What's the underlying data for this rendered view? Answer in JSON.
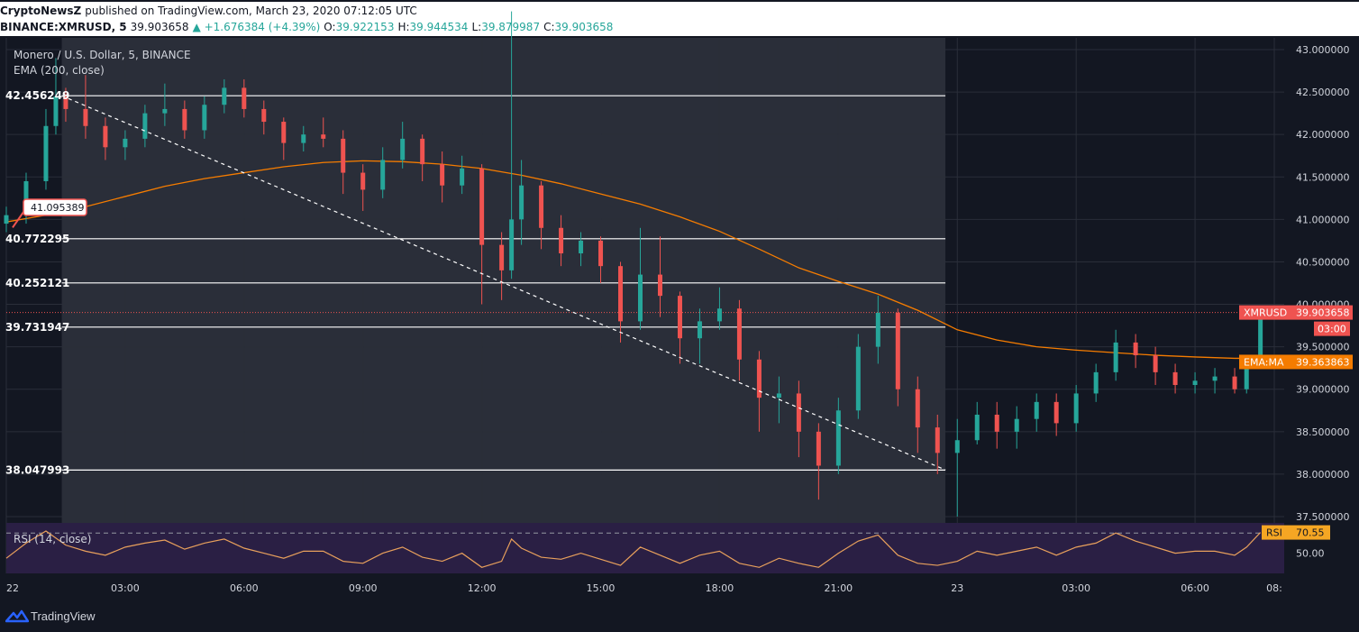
{
  "header": {
    "publisher": "CryptoNewsZ",
    "published_text": "published on TradingView.com, March 23, 2020 07:12:05 UTC",
    "symbol_label": "BINANCE:XMRUSD, 5",
    "last": "39.903658",
    "change": "▲ +1.676384 (+4.39%)",
    "o_label": "O:",
    "o": "39.922153",
    "h_label": "H:",
    "h": "39.944534",
    "l_label": "L:",
    "l": "39.879987",
    "c_label": "C:",
    "c": "39.903658"
  },
  "legend": {
    "title": "Monero / U.S. Dollar, 5, BINANCE",
    "ema": "EMA (200, close)",
    "rsi": "RSI (14, close)"
  },
  "brand": "TradingView",
  "colors": {
    "background": "#131722",
    "up": "#26a69a",
    "down": "#ef5350",
    "ema": "#f57c00",
    "rsi": "#e8a05c",
    "rsi_band": "#2a1f44",
    "highlight": "#2a2e39",
    "price_label": "#ef5350",
    "ema_label": "#f57c00",
    "rsi_label": "#f5a623"
  },
  "chart_data": {
    "type": "candlestick",
    "title": "Monero / U.S. Dollar, 5, BINANCE",
    "ylim": [
      37.5,
      43.0
    ],
    "y_ticks": [
      "43.000000",
      "42.500000",
      "42.000000",
      "41.500000",
      "41.000000",
      "40.500000",
      "40.000000",
      "39.500000",
      "39.000000",
      "38.500000",
      "38.000000",
      "37.500000"
    ],
    "x_tick_labels": [
      "22",
      "03:00",
      "06:00",
      "09:00",
      "12:00",
      "15:00",
      "18:00",
      "21:00",
      "23",
      "03:00",
      "06:00",
      "08:"
    ],
    "x_tick_hours": [
      0,
      3,
      6,
      9,
      12,
      15,
      18,
      21,
      24,
      27,
      30,
      32
    ],
    "xlim_hours": [
      0,
      32.25
    ],
    "highlight_range_hours": [
      1.4,
      23.7
    ],
    "levels": [
      {
        "value": 42.456249,
        "label": "42.456249"
      },
      {
        "value": 40.772295,
        "label": "40.772295"
      },
      {
        "value": 40.252121,
        "label": "40.252121"
      },
      {
        "value": 39.731947,
        "label": "39.731947"
      },
      {
        "value": 38.047993,
        "label": "38.047993"
      }
    ],
    "callout": {
      "label": "41.095389",
      "hour": 0.25,
      "value": 41.095389
    },
    "trendline": {
      "start": [
        1.4,
        42.456249
      ],
      "end": [
        23.7,
        38.05
      ]
    },
    "current_price": {
      "value": 39.903658,
      "label": "39.903658",
      "symbol": "XMRUSD",
      "countdown": "03:00"
    },
    "ema": {
      "name": "EMA (200, close)",
      "label_name": "EMA:MA",
      "value": 39.363863,
      "label": "39.363863",
      "points": [
        [
          0,
          40.97
        ],
        [
          1,
          41.05
        ],
        [
          2,
          41.15
        ],
        [
          3,
          41.27
        ],
        [
          4,
          41.39
        ],
        [
          5,
          41.48
        ],
        [
          6,
          41.55
        ],
        [
          7,
          41.62
        ],
        [
          8,
          41.67
        ],
        [
          9,
          41.69
        ],
        [
          10,
          41.68
        ],
        [
          11,
          41.65
        ],
        [
          12,
          41.6
        ],
        [
          13,
          41.52
        ],
        [
          14,
          41.42
        ],
        [
          15,
          41.3
        ],
        [
          16,
          41.18
        ],
        [
          17,
          41.03
        ],
        [
          18,
          40.86
        ],
        [
          19,
          40.65
        ],
        [
          20,
          40.43
        ],
        [
          21,
          40.27
        ],
        [
          22,
          40.12
        ],
        [
          23,
          39.93
        ],
        [
          24,
          39.7
        ],
        [
          25,
          39.58
        ],
        [
          26,
          39.5
        ],
        [
          27,
          39.46
        ],
        [
          28,
          39.43
        ],
        [
          29,
          39.4
        ],
        [
          30,
          39.38
        ],
        [
          31,
          39.364
        ],
        [
          31.65,
          39.364
        ]
      ]
    },
    "candles": [
      [
        0.0,
        40.95,
        41.05,
        41.15,
        40.85
      ],
      [
        0.5,
        41.05,
        41.45,
        41.55,
        40.95
      ],
      [
        1.0,
        41.45,
        42.1,
        42.3,
        41.35
      ],
      [
        1.25,
        42.1,
        42.45,
        42.9,
        42.0
      ],
      [
        1.5,
        42.45,
        42.3,
        42.55,
        42.15
      ],
      [
        2.0,
        42.3,
        42.1,
        42.7,
        41.95
      ],
      [
        2.5,
        42.1,
        41.85,
        42.2,
        41.7
      ],
      [
        3.0,
        41.85,
        41.95,
        42.05,
        41.7
      ],
      [
        3.5,
        41.95,
        42.25,
        42.35,
        41.85
      ],
      [
        4.0,
        42.25,
        42.3,
        42.6,
        42.1
      ],
      [
        4.5,
        42.3,
        42.05,
        42.4,
        41.95
      ],
      [
        5.0,
        42.05,
        42.35,
        42.45,
        41.95
      ],
      [
        5.5,
        42.35,
        42.55,
        42.65,
        42.25
      ],
      [
        6.0,
        42.55,
        42.3,
        42.65,
        42.2
      ],
      [
        6.5,
        42.3,
        42.15,
        42.4,
        42.0
      ],
      [
        7.0,
        42.15,
        41.9,
        42.2,
        41.7
      ],
      [
        7.5,
        41.9,
        42.0,
        42.1,
        41.8
      ],
      [
        8.0,
        42.0,
        41.95,
        42.2,
        41.85
      ],
      [
        8.5,
        41.95,
        41.55,
        42.05,
        41.3
      ],
      [
        9.0,
        41.55,
        41.35,
        41.65,
        41.1
      ],
      [
        9.5,
        41.35,
        41.7,
        41.85,
        41.25
      ],
      [
        10.0,
        41.7,
        41.95,
        42.15,
        41.6
      ],
      [
        10.5,
        41.95,
        41.65,
        42.0,
        41.45
      ],
      [
        11.0,
        41.65,
        41.4,
        41.8,
        41.2
      ],
      [
        11.5,
        41.4,
        41.6,
        41.75,
        41.3
      ],
      [
        12.0,
        41.6,
        40.7,
        41.65,
        40.0
      ],
      [
        12.5,
        40.7,
        40.4,
        40.85,
        40.05
      ],
      [
        12.75,
        40.4,
        41.0,
        43.45,
        40.3
      ],
      [
        13.0,
        41.0,
        41.4,
        41.7,
        40.7
      ],
      [
        13.5,
        41.4,
        40.9,
        41.45,
        40.65
      ],
      [
        14.0,
        40.9,
        40.6,
        41.05,
        40.45
      ],
      [
        14.5,
        40.6,
        40.75,
        40.85,
        40.45
      ],
      [
        15.0,
        40.75,
        40.45,
        40.8,
        40.25
      ],
      [
        15.5,
        40.45,
        39.8,
        40.5,
        39.55
      ],
      [
        16.0,
        39.8,
        40.35,
        40.9,
        39.7
      ],
      [
        16.5,
        40.35,
        40.1,
        40.8,
        39.85
      ],
      [
        17.0,
        40.1,
        39.6,
        40.15,
        39.3
      ],
      [
        17.5,
        39.6,
        39.8,
        39.95,
        39.3
      ],
      [
        18.0,
        39.8,
        39.95,
        40.2,
        39.7
      ],
      [
        18.5,
        39.95,
        39.35,
        40.05,
        39.1
      ],
      [
        19.0,
        39.35,
        38.9,
        39.45,
        38.5
      ],
      [
        19.5,
        38.9,
        38.95,
        39.15,
        38.6
      ],
      [
        20.0,
        38.95,
        38.5,
        39.1,
        38.2
      ],
      [
        20.5,
        38.5,
        38.1,
        38.6,
        37.7
      ],
      [
        21.0,
        38.1,
        38.75,
        38.9,
        38.0
      ],
      [
        21.5,
        38.75,
        39.5,
        39.65,
        38.65
      ],
      [
        22.0,
        39.5,
        39.9,
        40.1,
        39.3
      ],
      [
        22.5,
        39.9,
        39.0,
        39.95,
        38.8
      ],
      [
        23.0,
        39.0,
        38.55,
        39.15,
        38.25
      ],
      [
        23.5,
        38.55,
        38.25,
        38.7,
        38.0
      ],
      [
        24.0,
        38.25,
        38.4,
        38.65,
        37.5
      ],
      [
        24.5,
        38.4,
        38.7,
        38.85,
        38.35
      ],
      [
        25.0,
        38.7,
        38.5,
        38.85,
        38.3
      ],
      [
        25.5,
        38.5,
        38.65,
        38.8,
        38.3
      ],
      [
        26.0,
        38.65,
        38.85,
        38.95,
        38.5
      ],
      [
        26.5,
        38.85,
        38.6,
        38.95,
        38.45
      ],
      [
        27.0,
        38.6,
        38.95,
        39.05,
        38.5
      ],
      [
        27.5,
        38.95,
        39.2,
        39.3,
        38.85
      ],
      [
        28.0,
        39.2,
        39.55,
        39.7,
        39.1
      ],
      [
        28.5,
        39.55,
        39.4,
        39.65,
        39.25
      ],
      [
        29.0,
        39.4,
        39.2,
        39.5,
        39.05
      ],
      [
        29.5,
        39.2,
        39.05,
        39.3,
        38.95
      ],
      [
        30.0,
        39.05,
        39.1,
        39.2,
        38.95
      ],
      [
        30.5,
        39.1,
        39.15,
        39.25,
        38.95
      ],
      [
        31.0,
        39.15,
        39.0,
        39.25,
        38.95
      ],
      [
        31.3,
        39.0,
        39.3,
        39.35,
        38.95
      ],
      [
        31.65,
        39.3,
        39.9,
        39.95,
        39.25
      ]
    ],
    "rsi": {
      "name": "RSI (14, close)",
      "value": 70.55,
      "label": "70.55",
      "axis_label": "50.00",
      "ylim": [
        30,
        80
      ],
      "levels": [
        70,
        30
      ],
      "points": [
        [
          0,
          45
        ],
        [
          0.5,
          60
        ],
        [
          1.0,
          72
        ],
        [
          1.5,
          58
        ],
        [
          2.0,
          52
        ],
        [
          2.5,
          48
        ],
        [
          3.0,
          56
        ],
        [
          3.5,
          60
        ],
        [
          4.0,
          63
        ],
        [
          4.5,
          54
        ],
        [
          5.0,
          60
        ],
        [
          5.5,
          64
        ],
        [
          6.0,
          55
        ],
        [
          6.5,
          50
        ],
        [
          7.0,
          45
        ],
        [
          7.5,
          52
        ],
        [
          8.0,
          52
        ],
        [
          8.5,
          42
        ],
        [
          9.0,
          40
        ],
        [
          9.5,
          50
        ],
        [
          10.0,
          56
        ],
        [
          10.5,
          46
        ],
        [
          11.0,
          42
        ],
        [
          11.5,
          50
        ],
        [
          12.0,
          36
        ],
        [
          12.5,
          42
        ],
        [
          12.75,
          64
        ],
        [
          13.0,
          55
        ],
        [
          13.5,
          46
        ],
        [
          14.0,
          44
        ],
        [
          14.5,
          50
        ],
        [
          15.0,
          44
        ],
        [
          15.5,
          38
        ],
        [
          16.0,
          56
        ],
        [
          16.5,
          48
        ],
        [
          17.0,
          40
        ],
        [
          17.5,
          48
        ],
        [
          18.0,
          52
        ],
        [
          18.5,
          40
        ],
        [
          19.0,
          36
        ],
        [
          19.5,
          45
        ],
        [
          20.0,
          40
        ],
        [
          20.5,
          36
        ],
        [
          21.0,
          50
        ],
        [
          21.5,
          62
        ],
        [
          22.0,
          68
        ],
        [
          22.5,
          48
        ],
        [
          23.0,
          40
        ],
        [
          23.5,
          38
        ],
        [
          24.0,
          42
        ],
        [
          24.5,
          52
        ],
        [
          25.0,
          48
        ],
        [
          25.5,
          52
        ],
        [
          26.0,
          56
        ],
        [
          26.5,
          48
        ],
        [
          27.0,
          56
        ],
        [
          27.5,
          60
        ],
        [
          28.0,
          70
        ],
        [
          28.5,
          62
        ],
        [
          29.0,
          56
        ],
        [
          29.5,
          50
        ],
        [
          30.0,
          52
        ],
        [
          30.5,
          52
        ],
        [
          31.0,
          48
        ],
        [
          31.3,
          56
        ],
        [
          31.65,
          70.5
        ]
      ]
    }
  }
}
